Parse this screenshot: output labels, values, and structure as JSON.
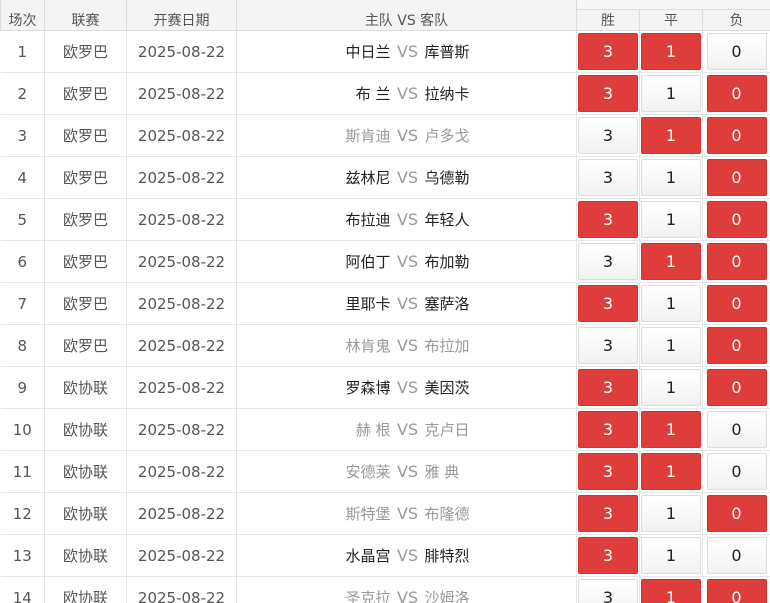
{
  "headers": {
    "no": "场次",
    "league": "联赛",
    "date": "开赛日期",
    "match": "主队 VS 客队",
    "win": "胜",
    "draw": "平",
    "lose": "负"
  },
  "vs_label": "VS",
  "colors": {
    "selected": "#df3c3c",
    "muted_team": "#999999"
  },
  "rows": [
    {
      "no": "1",
      "league": "欧罗巴",
      "date": "2025-08-22",
      "home": "中日兰",
      "away": "库普斯",
      "teams_muted": false,
      "win": "3",
      "draw": "1",
      "lose": "0",
      "sel": [
        true,
        true,
        false
      ]
    },
    {
      "no": "2",
      "league": "欧罗巴",
      "date": "2025-08-22",
      "home": "布 兰",
      "away": "拉纳卡",
      "teams_muted": false,
      "win": "3",
      "draw": "1",
      "lose": "0",
      "sel": [
        true,
        false,
        true
      ]
    },
    {
      "no": "3",
      "league": "欧罗巴",
      "date": "2025-08-22",
      "home": "斯肯迪",
      "away": "卢多戈",
      "teams_muted": true,
      "win": "3",
      "draw": "1",
      "lose": "0",
      "sel": [
        false,
        true,
        true
      ]
    },
    {
      "no": "4",
      "league": "欧罗巴",
      "date": "2025-08-22",
      "home": "兹林尼",
      "away": "乌德勒",
      "teams_muted": false,
      "win": "3",
      "draw": "1",
      "lose": "0",
      "sel": [
        false,
        false,
        true
      ]
    },
    {
      "no": "5",
      "league": "欧罗巴",
      "date": "2025-08-22",
      "home": "布拉迪",
      "away": "年轻人",
      "teams_muted": false,
      "win": "3",
      "draw": "1",
      "lose": "0",
      "sel": [
        true,
        false,
        true
      ]
    },
    {
      "no": "6",
      "league": "欧罗巴",
      "date": "2025-08-22",
      "home": "阿伯丁",
      "away": "布加勒",
      "teams_muted": false,
      "win": "3",
      "draw": "1",
      "lose": "0",
      "sel": [
        false,
        true,
        true
      ]
    },
    {
      "no": "7",
      "league": "欧罗巴",
      "date": "2025-08-22",
      "home": "里耶卡",
      "away": "塞萨洛",
      "teams_muted": false,
      "win": "3",
      "draw": "1",
      "lose": "0",
      "sel": [
        true,
        false,
        true
      ]
    },
    {
      "no": "8",
      "league": "欧罗巴",
      "date": "2025-08-22",
      "home": "林肯鬼",
      "away": "布拉加",
      "teams_muted": true,
      "win": "3",
      "draw": "1",
      "lose": "0",
      "sel": [
        false,
        false,
        true
      ]
    },
    {
      "no": "9",
      "league": "欧协联",
      "date": "2025-08-22",
      "home": "罗森博",
      "away": "美因茨",
      "teams_muted": false,
      "win": "3",
      "draw": "1",
      "lose": "0",
      "sel": [
        true,
        false,
        true
      ]
    },
    {
      "no": "10",
      "league": "欧协联",
      "date": "2025-08-22",
      "home": "赫 根",
      "away": "克卢日",
      "teams_muted": true,
      "win": "3",
      "draw": "1",
      "lose": "0",
      "sel": [
        true,
        true,
        false
      ]
    },
    {
      "no": "11",
      "league": "欧协联",
      "date": "2025-08-22",
      "home": "安德莱",
      "away": "雅 典",
      "teams_muted": true,
      "win": "3",
      "draw": "1",
      "lose": "0",
      "sel": [
        true,
        true,
        false
      ]
    },
    {
      "no": "12",
      "league": "欧协联",
      "date": "2025-08-22",
      "home": "斯特堡",
      "away": "布隆德",
      "teams_muted": true,
      "win": "3",
      "draw": "1",
      "lose": "0",
      "sel": [
        true,
        false,
        true
      ]
    },
    {
      "no": "13",
      "league": "欧协联",
      "date": "2025-08-22",
      "home": "水晶宫",
      "away": "腓特烈",
      "teams_muted": false,
      "win": "3",
      "draw": "1",
      "lose": "0",
      "sel": [
        true,
        false,
        false
      ]
    },
    {
      "no": "14",
      "league": "欧协联",
      "date": "2025-08-22",
      "home": "圣克拉",
      "away": "沙姆洛",
      "teams_muted": true,
      "win": "3",
      "draw": "1",
      "lose": "0",
      "sel": [
        false,
        true,
        true
      ]
    }
  ]
}
